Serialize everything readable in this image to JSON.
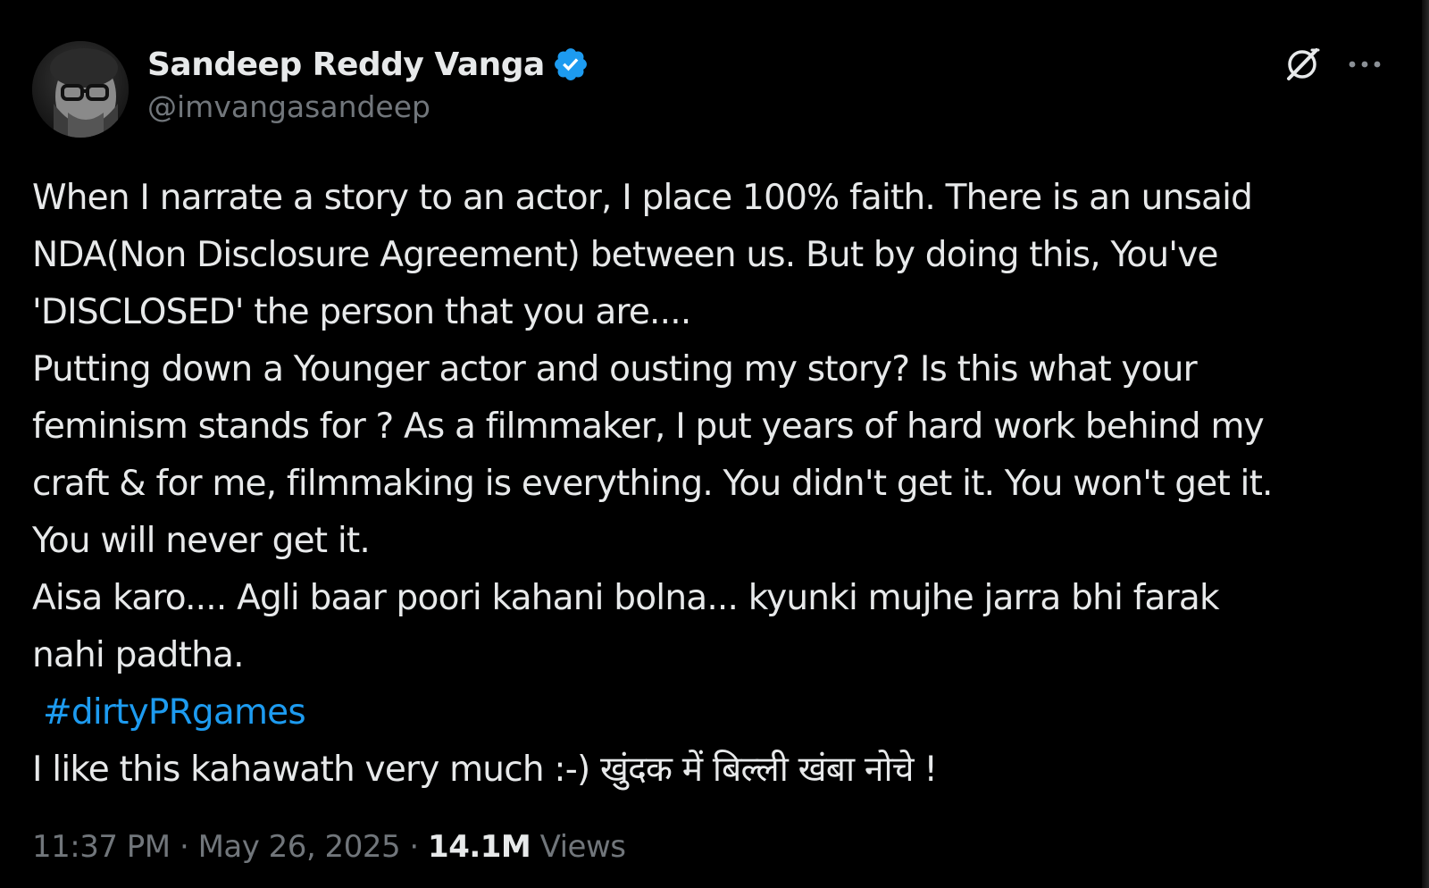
{
  "tweet": {
    "author": {
      "display_name": "Sandeep Reddy Vanga",
      "handle": "@imvangasandeep",
      "verified": true
    },
    "body_lines": [
      "When I narrate a story to an actor, I place 100% faith. There is an unsaid",
      "NDA(Non Disclosure Agreement) between us. But by doing this, You've",
      "'DISCLOSED' the person that you are....",
      "Putting down a Younger actor and ousting my story?  Is this what your",
      "feminism stands for ? As a filmmaker, I put years of hard work behind my",
      "craft & for me, filmmaking is everything. You didn't get it. You won't get it.",
      "You will never get it.",
      "Aisa karo.... Agli baar poori kahani bolna... kyunki mujhe jarra bhi farak",
      "nahi padtha."
    ],
    "hashtag": "#dirtyPRgames",
    "closing_line": "I like this kahawath very much :-) खुंदक में बिल्ली खंबा नोचे !",
    "time": "11:37 PM",
    "separator": "·",
    "date": "May 26, 2025",
    "views_count": "14.1M",
    "views_label": "Views"
  },
  "icons": {
    "verified": "verified-badge-icon",
    "grok": "grok-icon",
    "more": "more-options-icon"
  },
  "colors": {
    "background": "#000000",
    "text_primary": "#e7e9ea",
    "text_secondary": "#71767b",
    "accent": "#1d9bf0"
  }
}
